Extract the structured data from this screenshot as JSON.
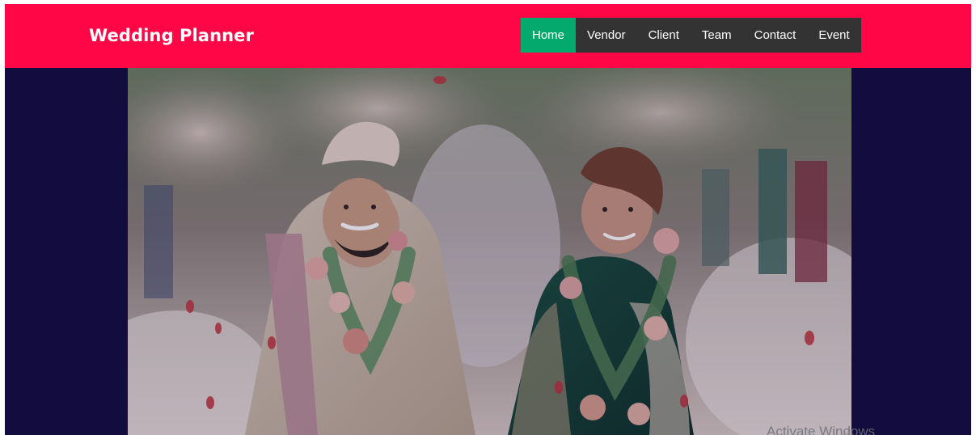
{
  "header": {
    "brand": "Wedding Planner"
  },
  "nav": {
    "items": [
      {
        "label": "Home",
        "active": true
      },
      {
        "label": "Vendor",
        "active": false
      },
      {
        "label": "Client",
        "active": false
      },
      {
        "label": "Team",
        "active": false
      },
      {
        "label": "Contact",
        "active": false
      },
      {
        "label": "Event",
        "active": false
      }
    ]
  },
  "hero": {
    "image": "wedding-couple-photo",
    "overlay_color": "#130d3f"
  },
  "watermark": {
    "text": "Activate Windows"
  },
  "colors": {
    "header_bg": "#ff0746",
    "nav_bg": "#333333",
    "nav_active": "#04aa6d",
    "page_bg": "#130d3f"
  }
}
